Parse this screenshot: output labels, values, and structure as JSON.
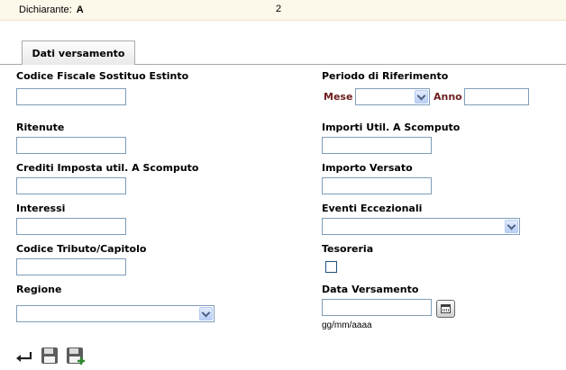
{
  "header": {
    "declarant_label": "Dichiarante:",
    "declarant_value": "A",
    "declarant_tail": "2"
  },
  "tabs": [
    {
      "label": "Dati versamento",
      "active": true
    }
  ],
  "form": {
    "left": {
      "codice_fiscale": {
        "label": "Codice Fiscale Sostituo Estinto",
        "value": ""
      },
      "ritenute": {
        "label": "Ritenute",
        "value": ""
      },
      "crediti": {
        "label": "Crediti Imposta util. A Scomputo",
        "value": ""
      },
      "interessi": {
        "label": "Interessi",
        "value": ""
      },
      "codice_tributo": {
        "label": "Codice Tributo/Capitolo",
        "value": ""
      },
      "regione": {
        "label": "Regione",
        "selected": ""
      }
    },
    "right": {
      "periodo": {
        "label": "Periodo di Riferimento",
        "mese_label": "Mese",
        "mese_selected": "",
        "anno_label": "Anno",
        "anno_value": ""
      },
      "importi_util": {
        "label": "Importi Util. A Scomputo",
        "value": ""
      },
      "importo_versato": {
        "label": "Importo Versato",
        "value": ""
      },
      "eventi": {
        "label": "Eventi Eccezionali",
        "selected": ""
      },
      "tesoreria": {
        "label": "Tesoreria",
        "checked": false
      },
      "data_versamento": {
        "label": "Data Versamento",
        "value": "",
        "format_hint": "gg/mm/aaaa"
      }
    }
  },
  "toolbar": {
    "icons": [
      "back-arrow-icon",
      "save-icon",
      "save-new-icon"
    ]
  },
  "colors": {
    "header_bg": "#fcf8ea",
    "field_border": "#7f9db9",
    "period_label": "#6e1e1e"
  }
}
